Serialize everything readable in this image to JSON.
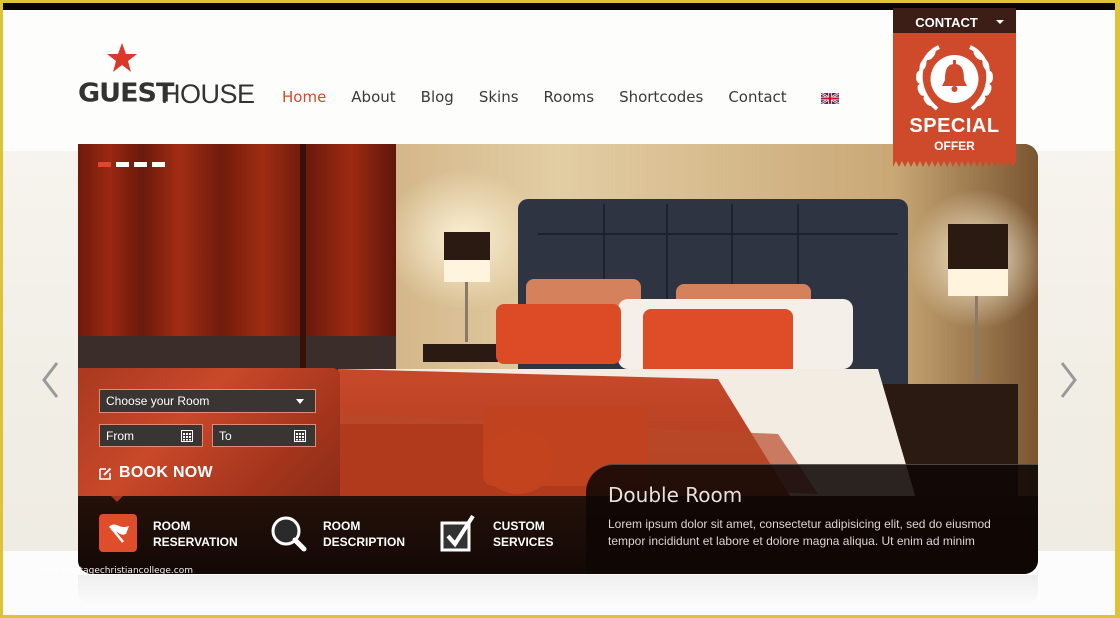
{
  "brand": {
    "name_bold": "GUEST",
    "name_light": "HOUSE",
    "accent": "#d5482a"
  },
  "nav": {
    "items": [
      {
        "label": "Home",
        "active": true
      },
      {
        "label": "About"
      },
      {
        "label": "Blog"
      },
      {
        "label": "Skins"
      },
      {
        "label": "Rooms"
      },
      {
        "label": "Shortcodes"
      },
      {
        "label": "Contact"
      }
    ],
    "language_icon": "uk-flag-icon"
  },
  "contact_tab": {
    "label": "CONTACT"
  },
  "special_offer": {
    "line1": "SPECIAL",
    "line2": "OFFER",
    "icon": "bell-icon"
  },
  "slider": {
    "slide_count": 4,
    "active_slide": 1,
    "caption": {
      "title": "Double Room",
      "text": "Lorem ipsum dolor sit amet, consectetur adipisicing elit, sed do eiusmod tempor incididunt et labore et dolore magna aliqua. Ut enim ad minim"
    }
  },
  "booking": {
    "room_select": {
      "value": "Choose your Room"
    },
    "from": {
      "placeholder": "From"
    },
    "to": {
      "placeholder": "To"
    },
    "button_label": "BOOK NOW"
  },
  "features": [
    {
      "line1": "ROOM",
      "line2": "RESERVATION",
      "icon": "flag-icon"
    },
    {
      "line1": "ROOM",
      "line2": "DESCRIPTION",
      "icon": "magnifier-icon"
    },
    {
      "line1": "CUSTOM",
      "line2": "SERVICES",
      "icon": "checkbox-icon"
    }
  ],
  "watermark": "www.heritagechristiancollege.com"
}
